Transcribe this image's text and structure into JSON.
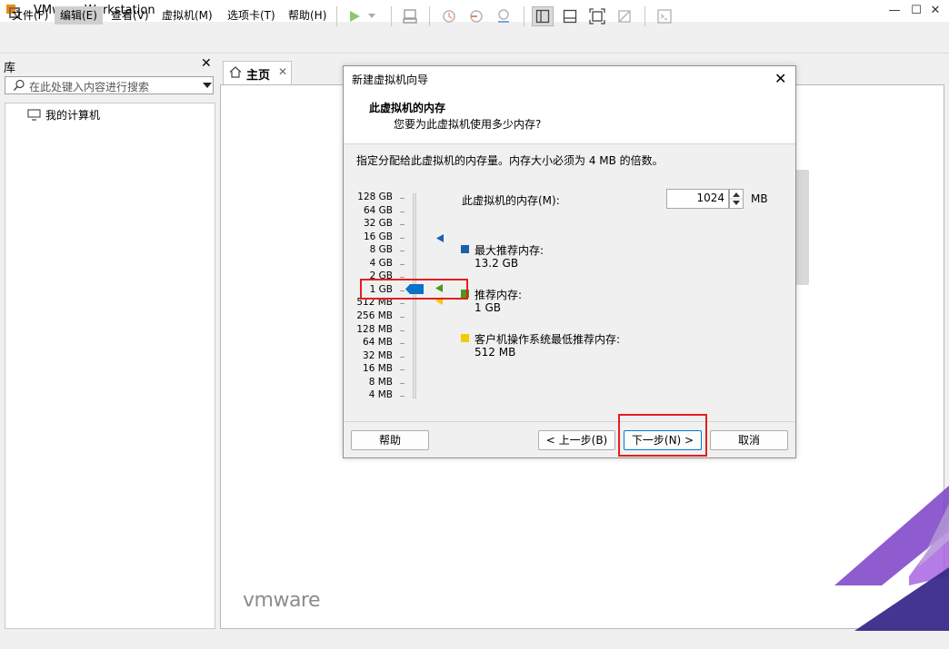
{
  "window": {
    "title": "VMware Workstation",
    "controls": [
      "—",
      "☐",
      "✕"
    ]
  },
  "menubar": {
    "items": [
      "文件(F)",
      "编辑(E)",
      "查看(V)",
      "虚拟机(M)",
      "选项卡(T)",
      "帮助(H)"
    ],
    "active_index": 1
  },
  "library": {
    "title": "库",
    "close": "✕",
    "search_placeholder": "在此处键入内容进行搜索",
    "tree_item": "我的计算机"
  },
  "tabs": {
    "home_label": "主页",
    "home_close": "✕"
  },
  "brand": {
    "logo_text": "vmware"
  },
  "dialog": {
    "title": "新建虚拟机向导",
    "close": "✕",
    "heading": "此虚拟机的内存",
    "subheading": "您要为此虚拟机使用多少内存?",
    "intro": "指定分配给此虚拟机的内存量。内存大小必须为 4 MB 的倍数。",
    "memory_label": "此虚拟机的内存(M):",
    "memory_value": "1024",
    "memory_unit": "MB",
    "slider_ticks": [
      "128 GB",
      "64 GB",
      "32 GB",
      "16 GB",
      "8 GB",
      "4 GB",
      "2 GB",
      "1 GB",
      "512 MB",
      "256 MB",
      "128 MB",
      "64 MB",
      "32 MB",
      "16 MB",
      "8 MB",
      "4 MB"
    ],
    "slider_selected": "1 GB",
    "legend": {
      "max_title": "最大推荐内存:",
      "max_value": "13.2 GB",
      "rec_title": "推荐内存:",
      "rec_value": "1 GB",
      "min_title": "客户机操作系统最低推荐内存:",
      "min_value": "512 MB"
    },
    "buttons": {
      "help": "帮助",
      "back": "< 上一步(B)",
      "next": "下一步(N) >",
      "cancel": "取消"
    }
  },
  "colors": {
    "max_marker": "#1c5fae",
    "rec_marker": "#4a9a1d",
    "min_marker": "#f2cc00",
    "highlight": "#e0201e",
    "corner_purple": "#7b3fc8"
  }
}
